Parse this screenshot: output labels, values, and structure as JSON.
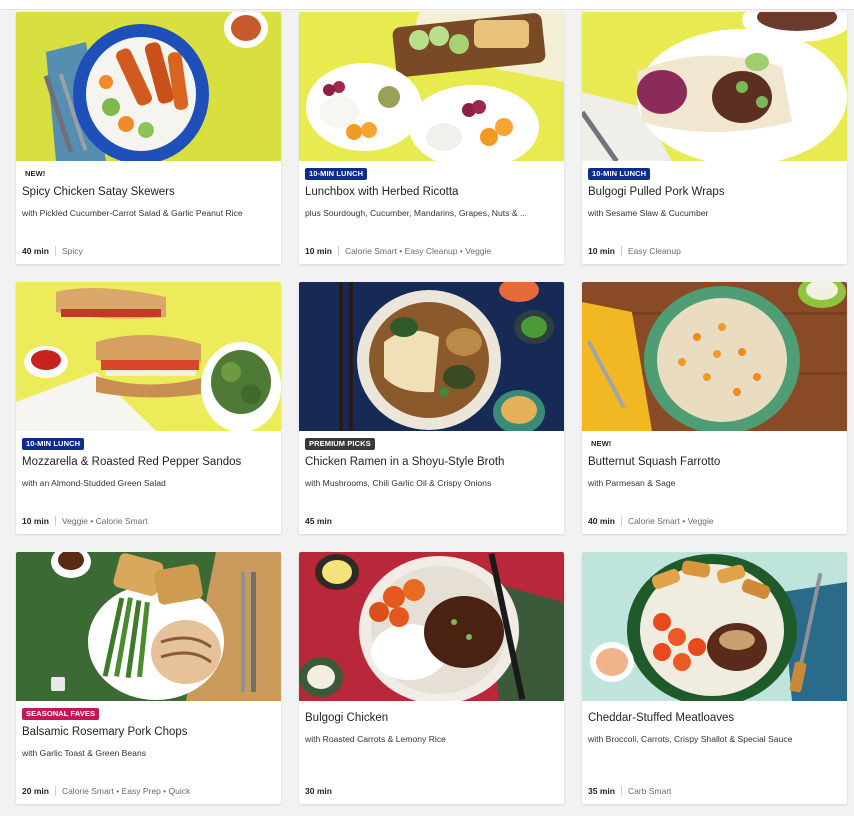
{
  "colors": {
    "lunch_badge": "#0d2c8c",
    "premium_badge": "#3a3a3a",
    "seasonal_badge": "#c2185b"
  },
  "cards": [
    {
      "badge": "NEW!",
      "title": "Spicy Chicken Satay Skewers",
      "subtitle": "with Pickled Cucumber-Carrot Salad & Garlic Peanut Rice",
      "time": "40 min",
      "tags": "Spicy"
    },
    {
      "badge": "10-MIN LUNCH",
      "title": "Lunchbox with Herbed Ricotta",
      "subtitle": "plus Sourdough, Cucumber, Mandarins, Grapes, Nuts & ...",
      "time": "10 min",
      "tags": "Calorie Smart • Easy Cleanup • Veggie"
    },
    {
      "badge": "10-MIN LUNCH",
      "title": "Bulgogi Pulled Pork Wraps",
      "subtitle": "with Sesame Slaw & Cucumber",
      "time": "10 min",
      "tags": "Easy Cleanup"
    },
    {
      "badge": "10-MIN LUNCH",
      "title": "Mozzarella & Roasted Red Pepper Sandos",
      "subtitle": "with an Almond-Studded Green Salad",
      "time": "10 min",
      "tags": "Veggie • Calorie Smart"
    },
    {
      "badge": "PREMIUM PICKS",
      "title": "Chicken Ramen in a Shoyu-Style Broth",
      "subtitle": "with Mushrooms, Chili Garlic Oil & Crispy Onions",
      "time": "45 min",
      "tags": ""
    },
    {
      "badge": "NEW!",
      "title": "Butternut Squash Farrotto",
      "subtitle": "with Parmesan & Sage",
      "time": "40 min",
      "tags": "Calorie Smart • Veggie"
    },
    {
      "badge": "SEASONAL FAVES",
      "title": "Balsamic Rosemary Pork Chops",
      "subtitle": "with Garlic Toast & Green Beans",
      "time": "20 min",
      "tags": "Calorie Smart • Easy Prep • Quick"
    },
    {
      "badge": "",
      "title": "Bulgogi Chicken",
      "subtitle": "with Roasted Carrots & Lemony Rice",
      "time": "30 min",
      "tags": ""
    },
    {
      "badge": "",
      "title": "Cheddar-Stuffed Meatloaves",
      "subtitle": "with Broccoli, Carrots, Crispy Shallot & Special Sauce",
      "time": "35 min",
      "tags": "Carb Smart"
    }
  ]
}
